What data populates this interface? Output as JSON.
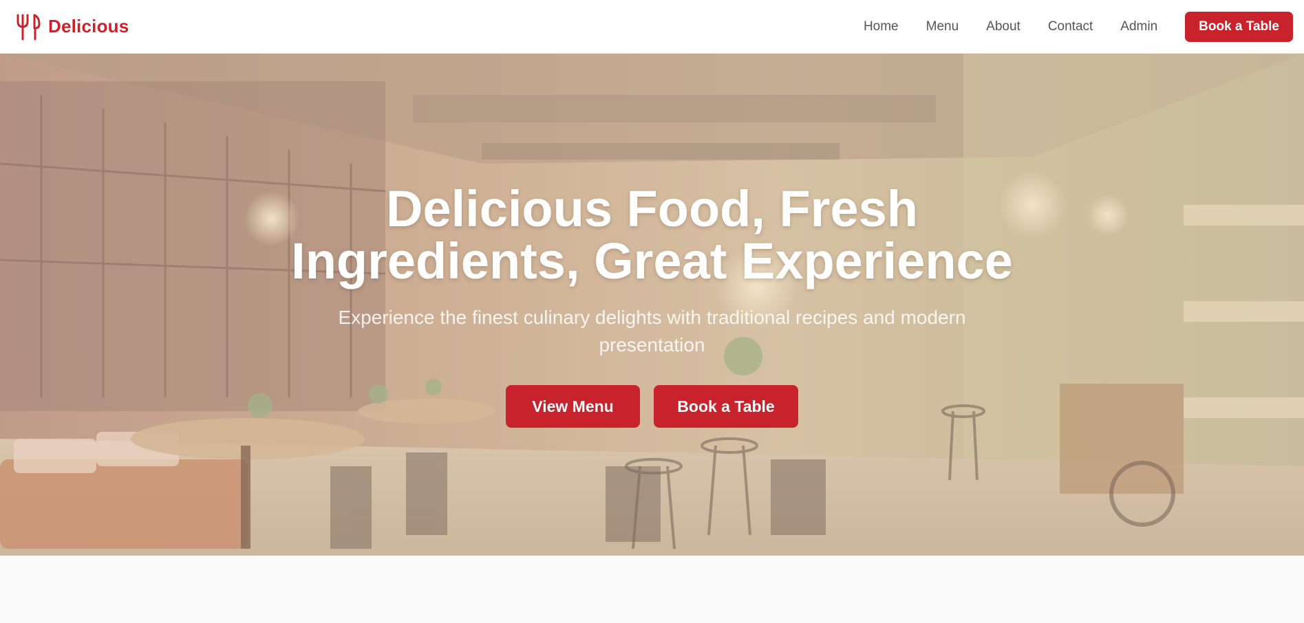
{
  "brand": {
    "name": "Delicious",
    "icon": "fork-knife-icon",
    "color": "#c8232c"
  },
  "nav": {
    "links": [
      "Home",
      "Menu",
      "About",
      "Contact",
      "Admin"
    ],
    "cta_label": "Book a Table"
  },
  "hero": {
    "title": "Delicious Food, Fresh Ingredients, Great Experience",
    "subtitle": "Experience the finest culinary delights with traditional recipes and modern presentation",
    "buttons": {
      "primary": "View Menu",
      "secondary": "Book a Table"
    },
    "background": "restaurant-interior-photo"
  },
  "colors": {
    "accent": "#c8232c",
    "nav_text": "#555555",
    "page_bg": "#fafafa"
  }
}
